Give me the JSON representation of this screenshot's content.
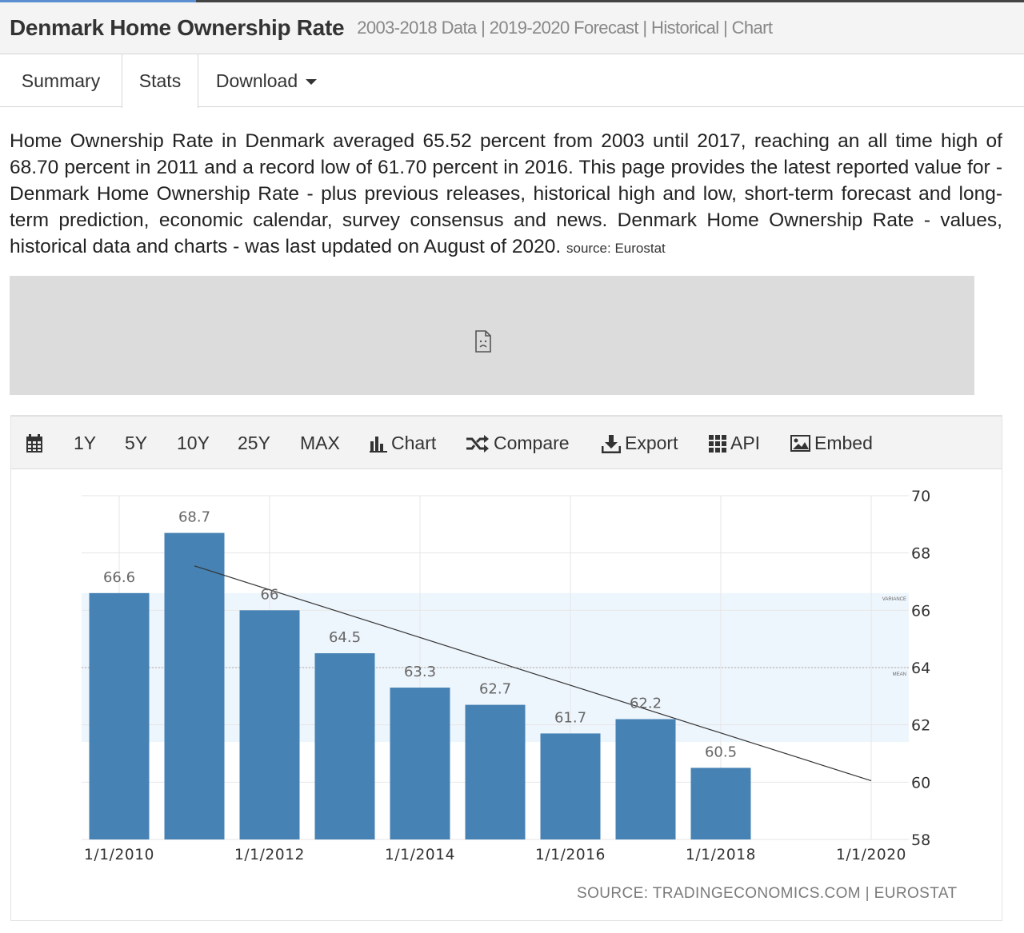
{
  "header": {
    "title": "Denmark Home Ownership Rate",
    "subtitle": "2003-2018 Data | 2019-2020 Forecast | Historical | Chart"
  },
  "tabs": [
    {
      "label": "Summary"
    },
    {
      "label": "Stats"
    },
    {
      "label": "Download"
    }
  ],
  "description": {
    "text": "Home Ownership Rate in Denmark averaged 65.52 percent from 2003 until 2017, reaching an all time high of 68.70 percent in 2011 and a record low of 61.70 percent in 2016. This page provides the latest reported value for - Denmark Home Ownership Rate - plus previous releases, historical high and low, short-term forecast and long-term prediction, economic calendar, survey consensus and news. Denmark Home Ownership Rate - values, historical data and charts - was last updated on August of 2020.",
    "source": "source: Eurostat"
  },
  "ad_icon": "broken-document-icon",
  "toolbar": {
    "calendar_icon": "calendar-icon",
    "ranges": [
      "1Y",
      "5Y",
      "10Y",
      "25Y",
      "MAX"
    ],
    "chart_label": "Chart",
    "compare_label": "Compare",
    "export_label": "Export",
    "api_label": "API",
    "embed_label": "Embed"
  },
  "colors": {
    "bar": "#4682b4",
    "variance_band": "#eef6fd",
    "trend_line": "#333333"
  },
  "chart_data": {
    "type": "bar",
    "title": "",
    "xlabel": "",
    "ylabel": "",
    "categories": [
      "2010",
      "2011",
      "2012",
      "2013",
      "2014",
      "2015",
      "2016",
      "2017",
      "2018"
    ],
    "values": [
      66.6,
      68.7,
      66,
      64.5,
      63.3,
      62.7,
      61.7,
      62.2,
      60.5
    ],
    "value_labels": [
      "66.6",
      "68.7",
      "66",
      "64.5",
      "63.3",
      "62.7",
      "61.7",
      "62.2",
      "60.5"
    ],
    "x_tick_labels": [
      "1/1/2010",
      "1/1/2012",
      "1/1/2014",
      "1/1/2016",
      "1/1/2018",
      "1/1/2020"
    ],
    "x_tick_years": [
      2010,
      2012,
      2014,
      2016,
      2018,
      2020
    ],
    "x_range_years": [
      2009.5,
      2020.5
    ],
    "ylim": [
      58,
      70
    ],
    "y_ticks": [
      58,
      60,
      62,
      64,
      66,
      68,
      70
    ],
    "y_axis_side": "right",
    "mean": 64,
    "mean_label": "MEAN",
    "variance_range": [
      61.4,
      66.6
    ],
    "variance_label": "VARIANCE",
    "trend_line": {
      "start": [
        2011,
        67.55
      ],
      "end": [
        2020,
        60.05
      ]
    },
    "grid": true,
    "source": "SOURCE: TRADINGECONOMICS.COM | EUROSTAT"
  }
}
